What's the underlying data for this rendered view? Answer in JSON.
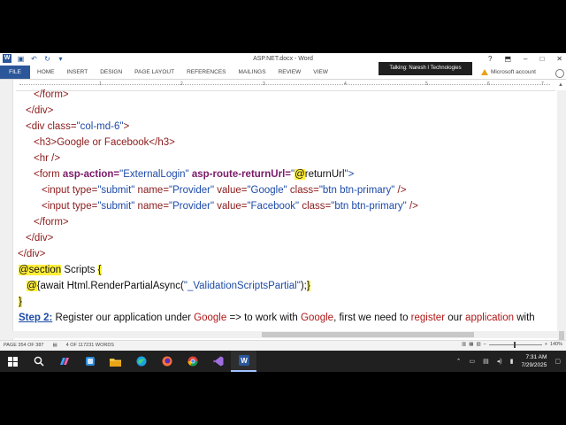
{
  "window": {
    "doc_title": "ASP.NET.docx - Word",
    "app_letter": "W"
  },
  "ribbon": {
    "file_tab": "FILE",
    "tabs": [
      "HOME",
      "INSERT",
      "DESIGN",
      "PAGE LAYOUT",
      "REFERENCES",
      "MAILINGS",
      "REVIEW",
      "VIEW"
    ],
    "talking_banner": "Talking: Naresh I Technologies",
    "account": "Microsoft account"
  },
  "ruler": {
    "numbers": [
      "1",
      "2",
      "3",
      "4",
      "5",
      "6",
      "7"
    ]
  },
  "code": {
    "l1": "</form>",
    "l2": "</div>",
    "l3_tag": "<div ",
    "l3_attr": "class=",
    "l3_val": "\"col-md-6\"",
    "l3_end": ">",
    "l4": "<h3>Google or Facebook</h3>",
    "l5": "<hr />",
    "l6_tag": "<form ",
    "l6_attr1": "asp-action=",
    "l6_val1": "\"ExternalLogin\"",
    "l6_attr2": " asp-route-returnUrl=",
    "l6_q": "\"",
    "l6_at": "@",
    "l6_var": "returnUrl",
    "l6_end": "\">",
    "l7_tag": "<input ",
    "l7_a1": "type=",
    "l7_v1": "\"submit\"",
    "l7_a2": " name=",
    "l7_v2": "\"Provider\"",
    "l7_a3": " value=",
    "l7_v3": "\"Google\"",
    "l7_a4": " class=",
    "l7_v4": "\"btn btn-primary\"",
    "l7_end": " />",
    "l8_tag": "<input ",
    "l8_a1": "type=",
    "l8_v1": "\"submit\"",
    "l8_a2": " name=",
    "l8_v2": "\"Provider\"",
    "l8_a3": " value=",
    "l8_v3": "\"Facebook\"",
    "l8_a4": " class=",
    "l8_v4": "\"btn btn-primary\"",
    "l8_end": " />",
    "l9": "</form>",
    "l10": "</div>",
    "l11": "</div>",
    "l12_kw": "@section",
    "l12_rest": " Scripts ",
    "l12_brace": "{",
    "l13_at": "@",
    "l13_pre": "{await Html.RenderPartialAsync(",
    "l13_str": "\"_ValidationScriptsPartial\"",
    "l13_post": ");",
    "l13_brace": "}",
    "l14": "}"
  },
  "step": {
    "label": "Step 2:",
    "t1": " Register our application under ",
    "google1": "Google",
    "t2": " => to work with ",
    "google2": "Google",
    "t3": ", first we need to ",
    "register": "register",
    "t4": " our ",
    "application": "application",
    "t5": " with"
  },
  "status": {
    "page": "PAGE 354 OF 387",
    "words": "4 OF 117231 WORDS",
    "zoom": "140%"
  },
  "tray": {
    "time": "7:31 AM",
    "date": "7/29/2025"
  }
}
